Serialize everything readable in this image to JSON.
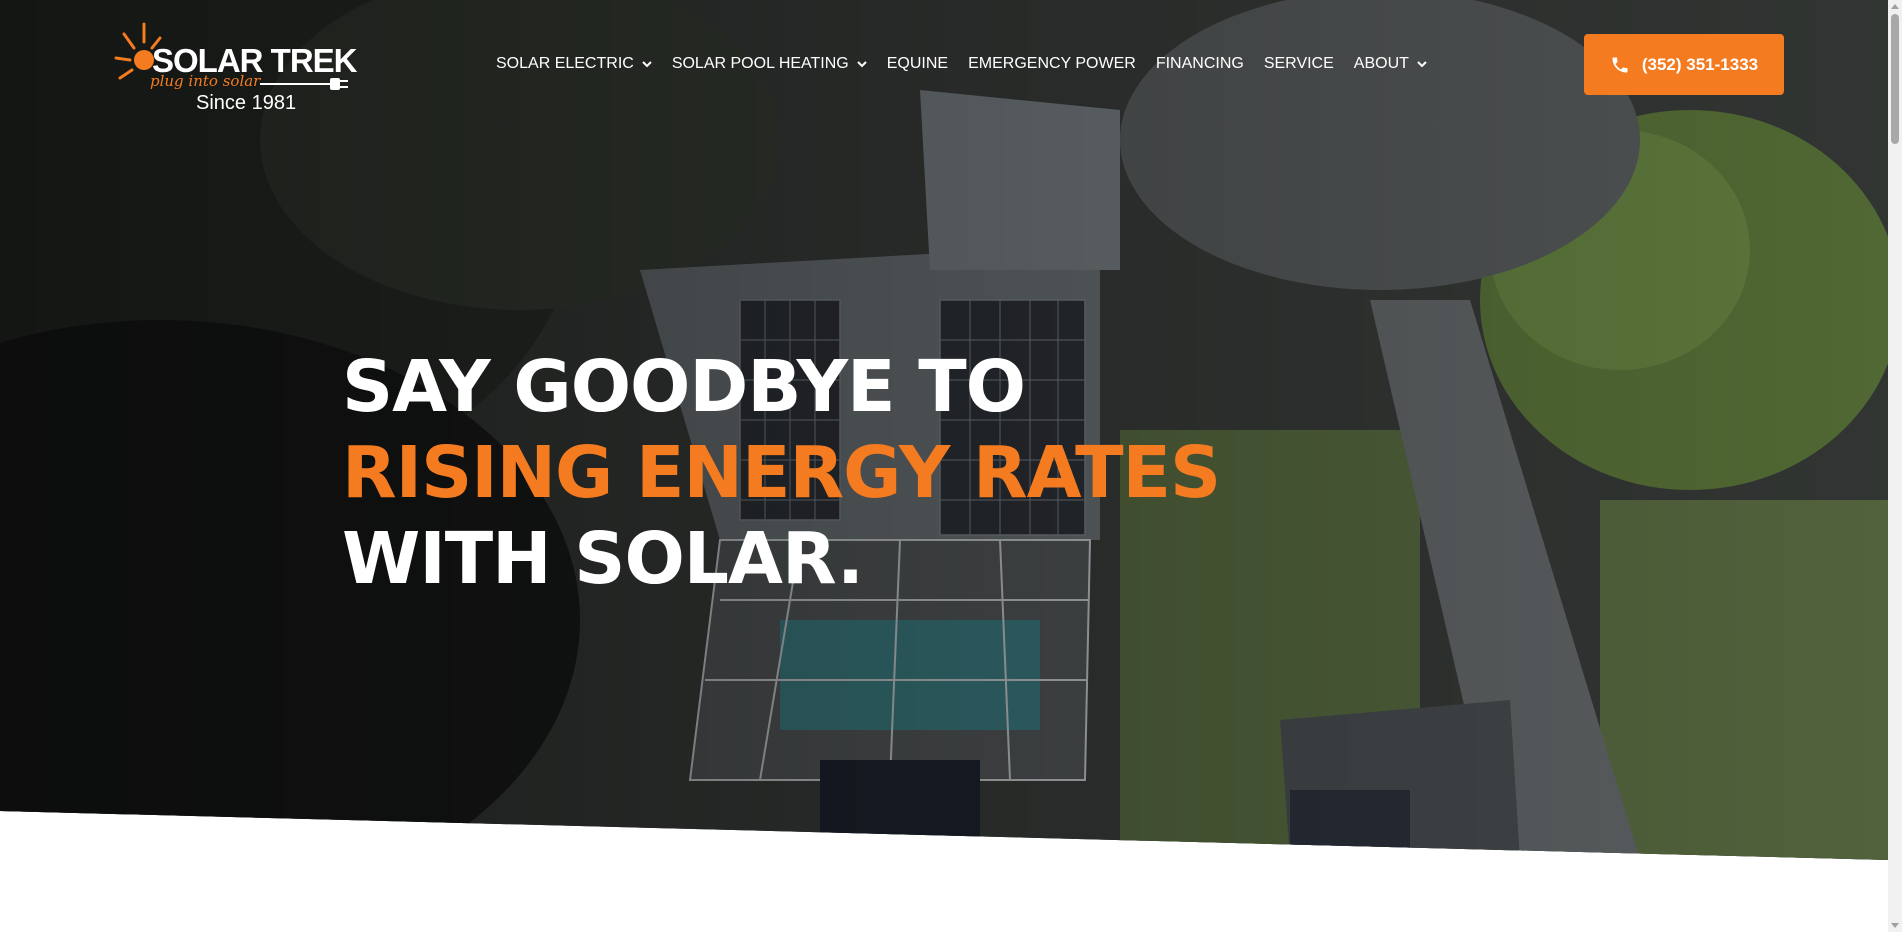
{
  "header": {
    "logo": {
      "wordmark": "SOLAR TREK",
      "tagline": "plug into solar",
      "since": "Since 1981"
    },
    "nav": [
      {
        "label": "SOLAR ELECTRIC",
        "has_dropdown": true
      },
      {
        "label": "SOLAR POOL HEATING",
        "has_dropdown": true
      },
      {
        "label": "EQUINE",
        "has_dropdown": false
      },
      {
        "label": "EMERGENCY POWER",
        "has_dropdown": false
      },
      {
        "label": "FINANCING",
        "has_dropdown": false
      },
      {
        "label": "SERVICE",
        "has_dropdown": false
      },
      {
        "label": "ABOUT",
        "has_dropdown": true
      }
    ],
    "cta": {
      "label": "(352) 351-1333",
      "icon": "phone-icon"
    }
  },
  "hero": {
    "line1": "SAY GOODBYE TO",
    "line2": "RISING ENERGY RATES",
    "line3": "WITH SOLAR."
  },
  "colors": {
    "accent": "#f47b20",
    "text_light": "#ffffff",
    "page_bg": "#ffffff"
  }
}
